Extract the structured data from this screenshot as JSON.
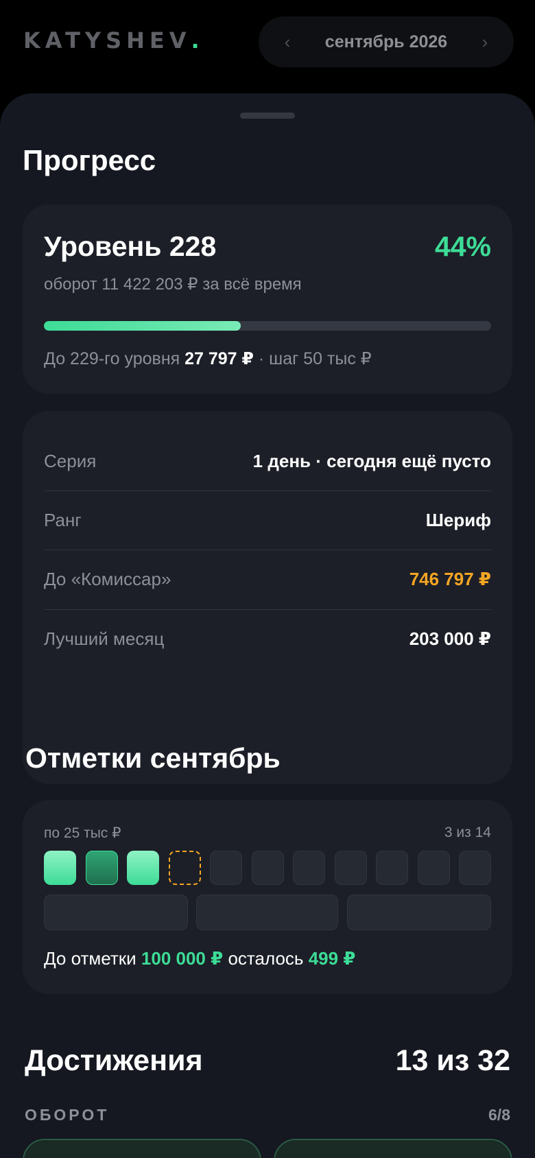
{
  "header": {
    "logo_text": "KATYSHEV",
    "logo_dot": ".",
    "month_label": "сентябрь 2026",
    "prev_arrow": "‹",
    "next_arrow": "›"
  },
  "progress": {
    "section_title": "Прогресс",
    "level_title": "Уровень 228",
    "level_percent": "44%",
    "level_percent_value": 44,
    "turnover_text": "оборот 11 422 203 ₽ за всё время",
    "next_level_prefix": "До 229-го уровня",
    "next_level_amount": "27 797 ₽",
    "next_level_suffix": "· шаг 50 тыс ₽"
  },
  "stats": [
    {
      "label": "Серия",
      "value": "1 день · сегодня ещё пусто",
      "accent": "white"
    },
    {
      "label": "Ранг",
      "value": "Шериф",
      "accent": "white"
    },
    {
      "label": "До «Комиссар»",
      "value": "746 797 ₽",
      "accent": "orange"
    },
    {
      "label": "Лучший месяц",
      "value": "203 000 ₽",
      "accent": "white"
    }
  ],
  "marks": {
    "section_title": "Отметки сентябрь",
    "step_label": "по 25 тыс ₽",
    "count_label": "3 из 14",
    "tiles": [
      "on",
      "on-dark",
      "on",
      "next",
      "off",
      "off",
      "off",
      "off",
      "off",
      "off",
      "off"
    ],
    "big_tiles": 3,
    "foot_prefix": "До отметки",
    "foot_target": "100 000 ₽",
    "foot_middle": "осталось",
    "foot_remaining": "499 ₽"
  },
  "achievements": {
    "title": "Достижения",
    "count": "13 из 32",
    "category_label": "ОБОРОТ",
    "category_count": "6/8"
  },
  "colors": {
    "accent_green": "#3ddc97",
    "accent_orange": "#f5a623",
    "sheet_bg": "#151820",
    "card_bg": "#1c1f27"
  }
}
